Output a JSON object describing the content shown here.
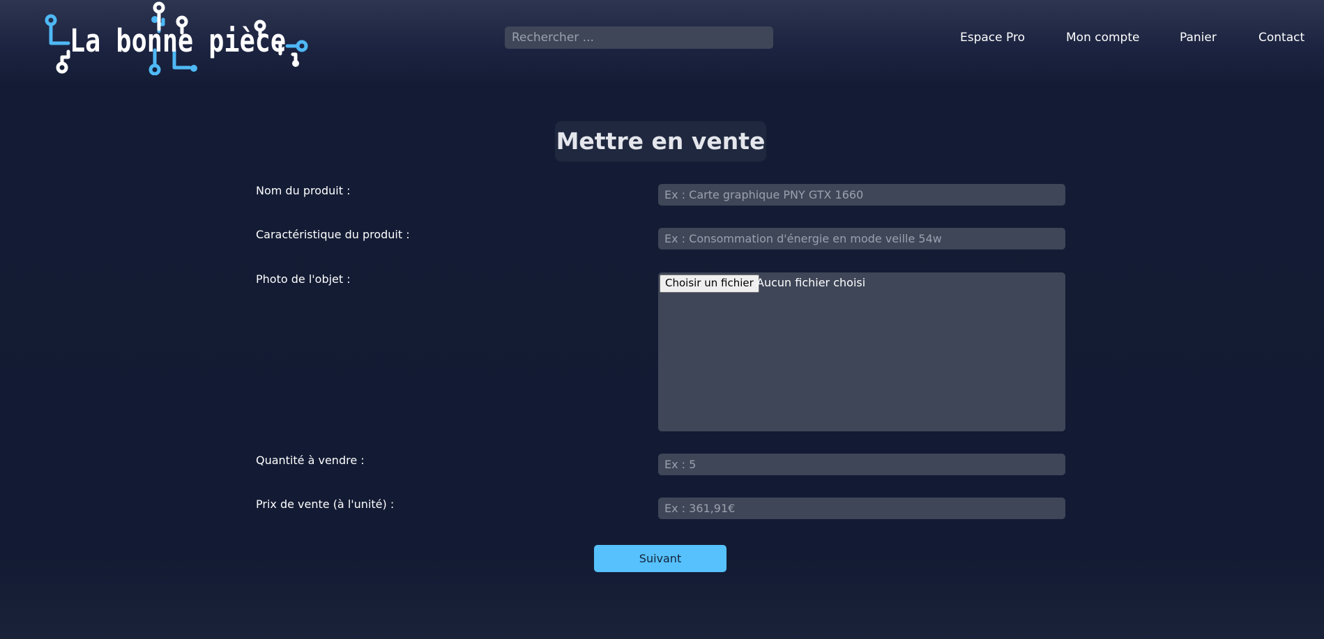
{
  "header": {
    "logo_text": "La bonne pièce",
    "search": {
      "placeholder": "Rechercher ...",
      "value": ""
    },
    "nav": {
      "espace_pro": "Espace Pro",
      "mon_compte": "Mon compte",
      "panier": "Panier",
      "contact": "Contact"
    }
  },
  "form": {
    "title": "Mettre en vente",
    "fields": {
      "nom": {
        "label": "Nom du produit :",
        "placeholder": "Ex : Carte graphique PNY GTX 1660"
      },
      "caracteristique": {
        "label": "Caractéristique du produit :",
        "placeholder": "Ex : Consommation d'énergie en mode veille 54w"
      },
      "photo": {
        "label": "Photo de l'objet :",
        "button": "Choisir un fichier",
        "status": "Aucun fichier choisi"
      },
      "quantite": {
        "label": "Quantité à vendre :",
        "placeholder": "Ex : 5"
      },
      "prix": {
        "label": "Prix de vente (à l'unité) :",
        "placeholder": "Ex : 361,91€"
      }
    },
    "submit_label": "Suivant"
  },
  "colors": {
    "background": "#131c34",
    "field_bg": "#3f4658",
    "accent": "#56c1fc",
    "logo_blue": "#4fb8f5"
  }
}
